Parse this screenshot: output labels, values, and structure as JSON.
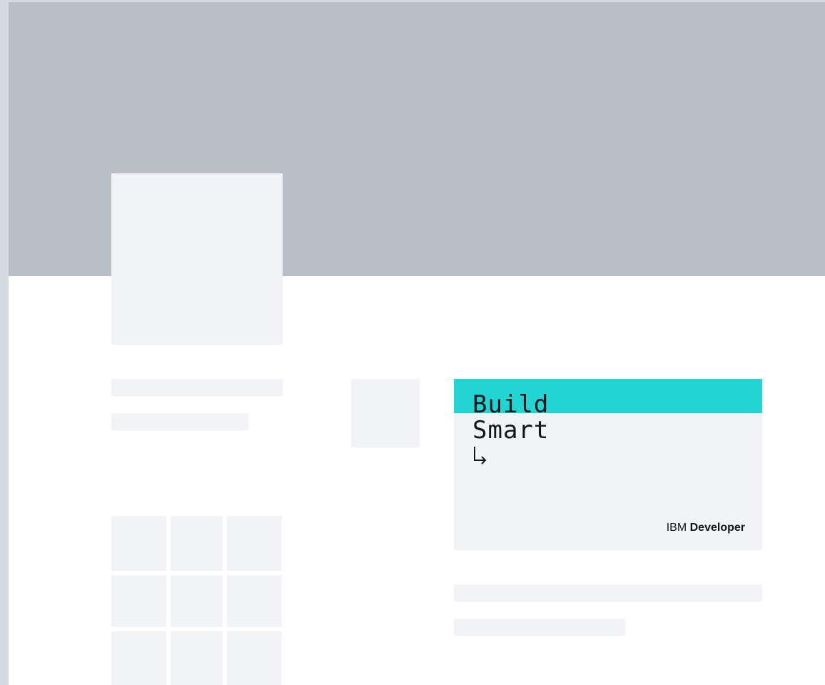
{
  "colors": {
    "cover": "#b8bfc7",
    "placeholder": "#f2f3f6",
    "accent": "#22d5d3"
  },
  "promo_card": {
    "title_line_1": "Build",
    "title_line_2": "Smart",
    "arrow_icon": "arrow-down-right-icon",
    "brand_prefix": "IBM",
    "brand_name": "Developer"
  }
}
